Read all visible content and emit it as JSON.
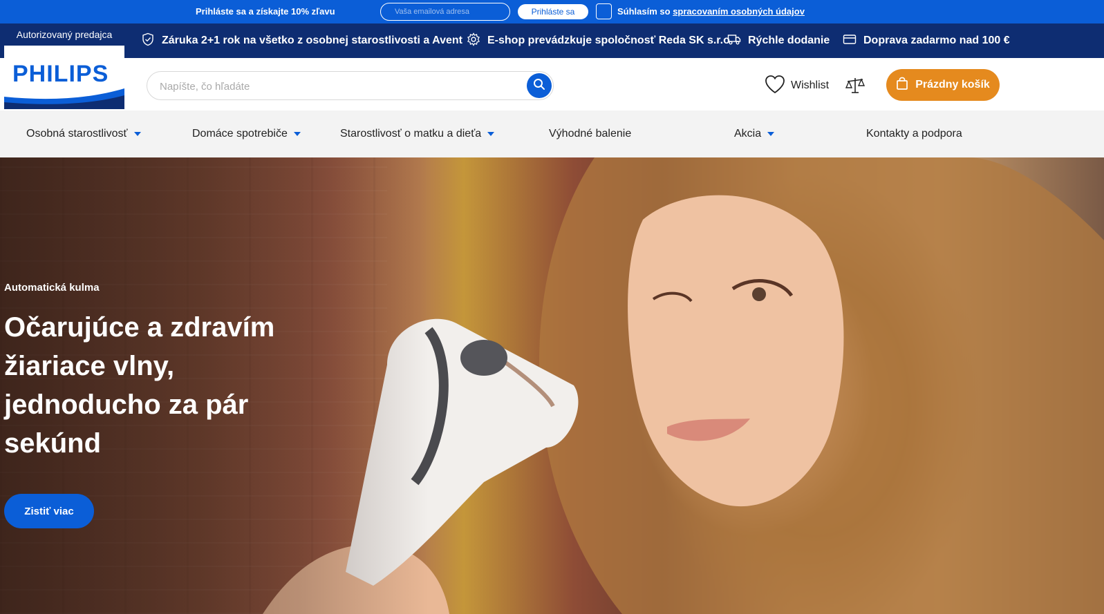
{
  "newsletter": {
    "promo_text": "Prihláste sa a získajte 10% zľavu",
    "email_placeholder": "Vaša emailová adresa",
    "login_label": "Prihláste sa",
    "consent_prefix": "Súhlasím so ",
    "consent_link": "spracovaním osobných údajov"
  },
  "info_bar": {
    "items": [
      {
        "icon": "shield-icon",
        "label": "Záruka 2+1 rok na všetko z osobnej starostlivosti a Avent"
      },
      {
        "icon": "gear-icon",
        "label": "E-shop prevádzkuje spoločnosť Reda SK s.r.o."
      },
      {
        "icon": "truck-icon",
        "label": "Rýchle dodanie"
      },
      {
        "icon": "card-icon",
        "label": "Doprava zadarmo nad 100 €"
      }
    ]
  },
  "brand": {
    "authorized_label": "Autorizovaný predajca",
    "logo_text": "PHILIPS"
  },
  "search": {
    "placeholder": "Napíšte, čo hľadáte"
  },
  "header": {
    "wishlist_label": "Wishlist",
    "cart_label": "Prázdny košík"
  },
  "nav": {
    "items": [
      {
        "label": "Osobná starostlivosť",
        "has_dropdown": true
      },
      {
        "label": "Domáce spotrebiče",
        "has_dropdown": true
      },
      {
        "label": "Starostlivosť o matku a dieťa",
        "has_dropdown": true
      },
      {
        "label": "Výhodné balenie",
        "has_dropdown": false
      },
      {
        "label": "Akcia",
        "has_dropdown": true
      },
      {
        "label": "Kontakty a podpora",
        "has_dropdown": false
      }
    ]
  },
  "hero": {
    "eyebrow": "Automatická kulma",
    "headline": "Očarujúce a zdravím žiariace vlny, jednoducho za pár sekúnd",
    "cta_label": "Zistiť viac"
  },
  "colors": {
    "brand_blue": "#0b5ed7",
    "navy": "#0e2d72",
    "cart_orange": "#e58a1e"
  }
}
